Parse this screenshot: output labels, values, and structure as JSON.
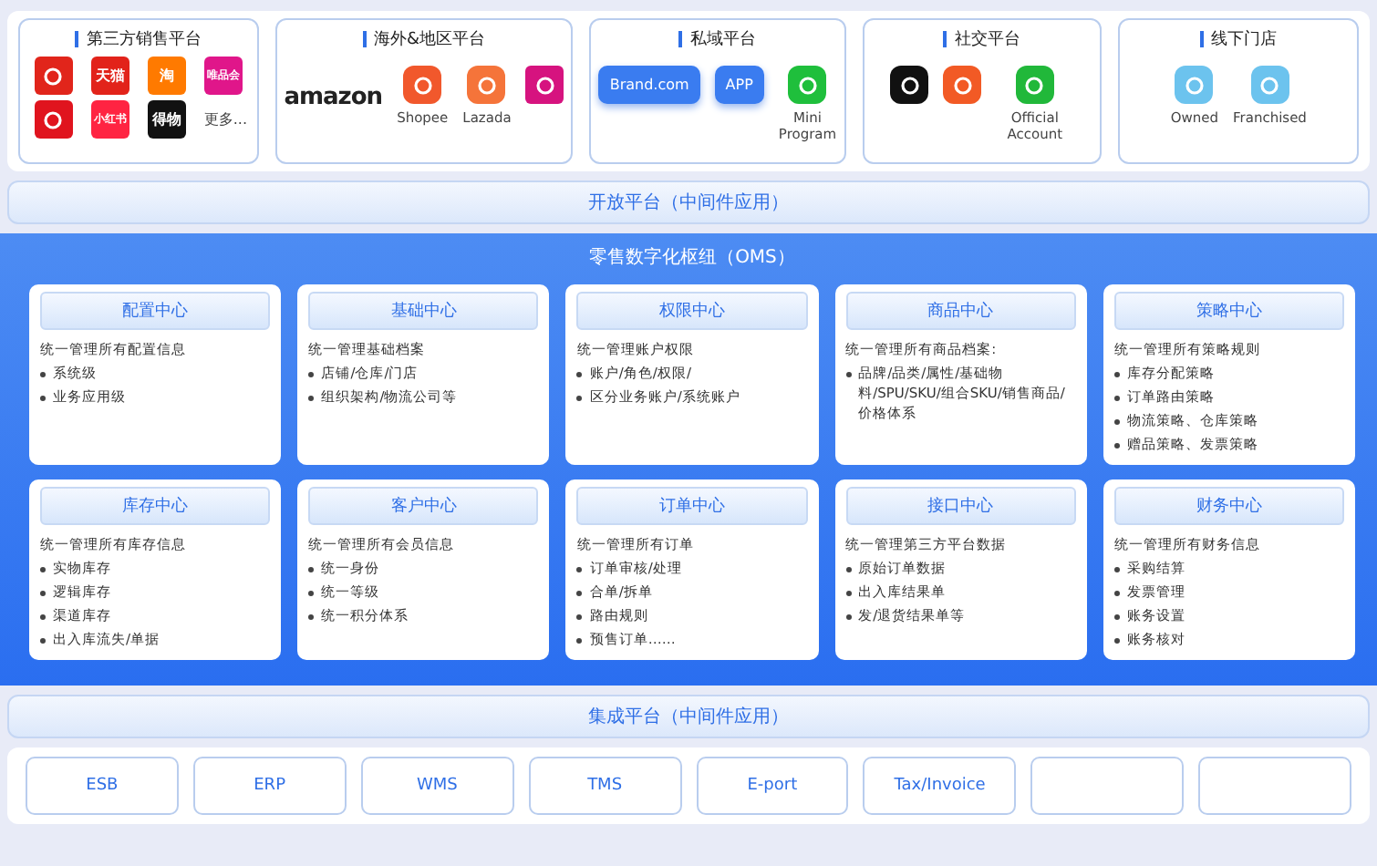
{
  "channels": [
    {
      "title": "第三方销售平台",
      "items": [
        {
          "kind": "tile",
          "color": "#e1251b"
        },
        {
          "kind": "tile",
          "color": "#e2231a",
          "label": "天猫"
        },
        {
          "kind": "tile",
          "color": "#ff7a00",
          "label": "淘"
        },
        {
          "kind": "tile",
          "color": "#e0168a",
          "label": "唯品会"
        },
        {
          "kind": "tile",
          "color": "#e0141e"
        },
        {
          "kind": "tile",
          "color": "#ff2442",
          "label": "小红书"
        },
        {
          "kind": "tile",
          "color": "#111111",
          "label": "得物"
        },
        {
          "kind": "more",
          "label": "更多..."
        }
      ]
    },
    {
      "title": "海外&地区平台",
      "items": [
        {
          "kind": "wordmark",
          "label": "amazon"
        },
        {
          "kind": "app",
          "color": "#f1582c",
          "caption": "Shopee"
        },
        {
          "kind": "app",
          "color": "#f5743a",
          "caption": "Lazada"
        },
        {
          "kind": "tile",
          "color": "#d6137f"
        }
      ]
    },
    {
      "title": "私域平台",
      "items": [
        {
          "kind": "pill",
          "label": "Brand.com"
        },
        {
          "kind": "pill",
          "label": "APP"
        },
        {
          "kind": "app",
          "color": "#1fbf3c",
          "caption": "Mini Program"
        }
      ]
    },
    {
      "title": "社交平台",
      "items": [
        {
          "kind": "app",
          "color": "#111111"
        },
        {
          "kind": "app",
          "color": "#f25a25"
        },
        {
          "kind": "app",
          "color": "#21b83a",
          "caption": "Official Account"
        }
      ]
    },
    {
      "title": "线下门店",
      "items": [
        {
          "kind": "app",
          "color": "#6cc3ee",
          "caption": "Owned"
        },
        {
          "kind": "app",
          "color": "#6cc3ee",
          "caption": "Franchised"
        }
      ]
    }
  ],
  "open_platform": "开放平台（中间件应用）",
  "oms": {
    "title": "零售数字化枢纽（OMS）",
    "centers": [
      {
        "title": "配置中心",
        "intro": "统一管理所有配置信息",
        "points": [
          "系统级",
          "业务应用级"
        ]
      },
      {
        "title": "基础中心",
        "intro": "统一管理基础档案",
        "points": [
          "店铺/仓库/门店",
          "组织架构/物流公司等"
        ]
      },
      {
        "title": "权限中心",
        "intro": "统一管理账户权限",
        "points": [
          "账户/角色/权限/",
          "区分业务账户/系统账户"
        ]
      },
      {
        "title": "商品中心",
        "intro": "统一管理所有商品档案:",
        "points": [
          "品牌/品类/属性/基础物料/SPU/SKU/组合SKU/销售商品/价格体系"
        ]
      },
      {
        "title": "策略中心",
        "intro": "统一管理所有策略规则",
        "points": [
          "库存分配策略",
          "订单路由策略",
          "物流策略、仓库策略",
          "赠品策略、发票策略"
        ]
      },
      {
        "title": "库存中心",
        "intro": "统一管理所有库存信息",
        "points": [
          "实物库存",
          "逻辑库存",
          "渠道库存",
          "出入库流失/单据"
        ]
      },
      {
        "title": "客户中心",
        "intro": "统一管理所有会员信息",
        "points": [
          "统一身份",
          "统一等级",
          "统一积分体系"
        ]
      },
      {
        "title": "订单中心",
        "intro": "统一管理所有订单",
        "points": [
          "订单审核/处理",
          "合单/拆单",
          "路由规则",
          "预售订单……"
        ]
      },
      {
        "title": "接口中心",
        "intro": "统一管理第三方平台数据",
        "points": [
          "原始订单数据",
          "出入库结果单",
          "发/退货结果单等"
        ]
      },
      {
        "title": "财务中心",
        "intro": "统一管理所有财务信息",
        "points": [
          "采购结算",
          "发票管理",
          "账务设置",
          "账务核对"
        ]
      }
    ]
  },
  "integration_platform": "集成平台（中间件应用）",
  "systems": [
    {
      "kind": "text",
      "label": "ESB"
    },
    {
      "kind": "text",
      "label": "ERP"
    },
    {
      "kind": "text",
      "label": "WMS"
    },
    {
      "kind": "text",
      "label": "TMS"
    },
    {
      "kind": "text",
      "label": "E-port"
    },
    {
      "kind": "text",
      "label": "Tax/Invoice"
    },
    {
      "kind": "blank"
    },
    {
      "kind": "blank"
    }
  ]
}
